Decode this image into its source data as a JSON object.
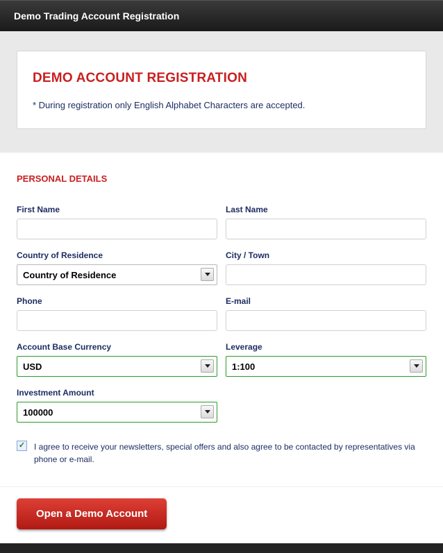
{
  "window": {
    "title": "Demo Trading Account Registration"
  },
  "header": {
    "title": "DEMO ACCOUNT REGISTRATION",
    "note": "* During registration only English Alphabet Characters are accepted."
  },
  "form": {
    "section_title": "PERSONAL DETAILS",
    "first_name": {
      "label": "First Name",
      "value": ""
    },
    "last_name": {
      "label": "Last Name",
      "value": ""
    },
    "country": {
      "label": "Country of Residence",
      "value": "Country of Residence"
    },
    "city": {
      "label": "City / Town",
      "value": ""
    },
    "phone": {
      "label": "Phone",
      "value": ""
    },
    "email": {
      "label": "E-mail",
      "value": ""
    },
    "currency": {
      "label": "Account Base Currency",
      "value": "USD"
    },
    "leverage": {
      "label": "Leverage",
      "value": "1:100"
    },
    "investment": {
      "label": "Investment Amount",
      "value": "100000"
    },
    "agree": {
      "checked": true,
      "text": "I agree to receive your newsletters, special offers and also agree to be contacted by representatives via phone or e-mail."
    },
    "submit": {
      "label": "Open a Demo Account"
    }
  }
}
